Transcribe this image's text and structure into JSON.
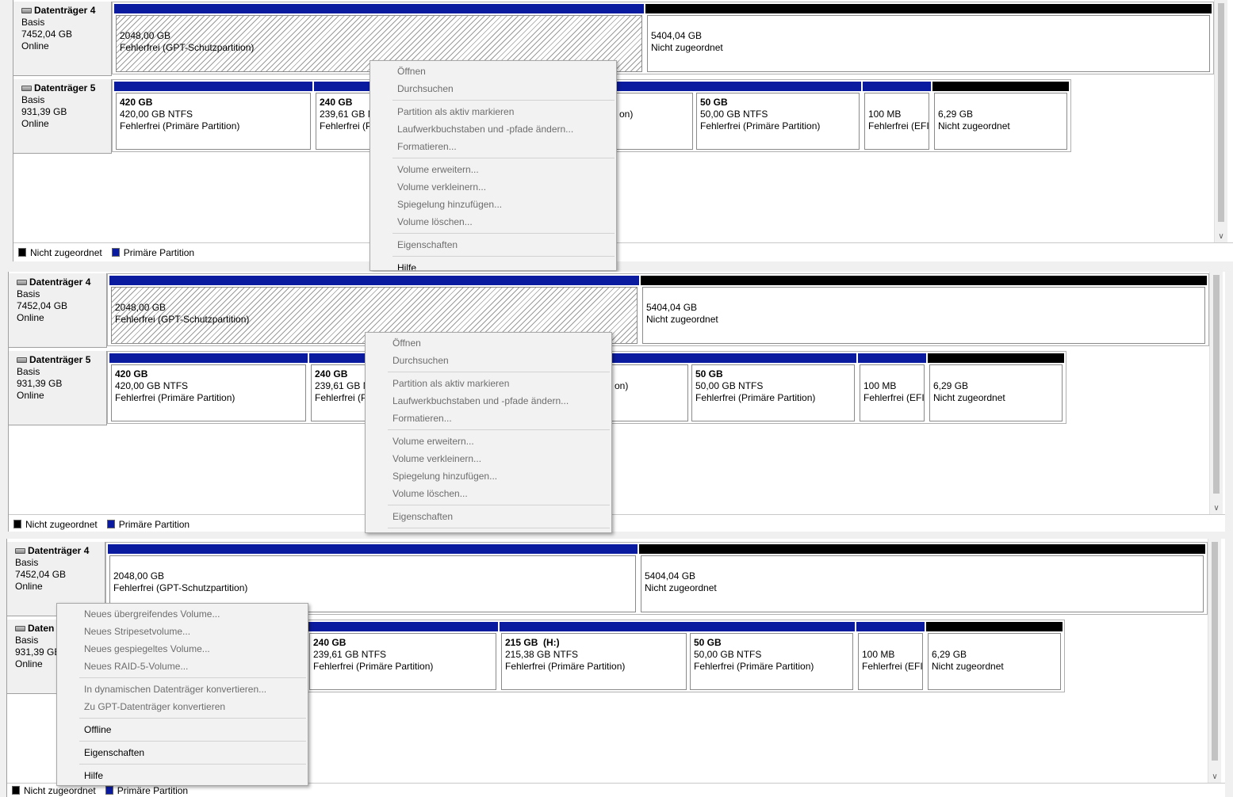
{
  "legend": {
    "unallocated": "Nicht zugeordnet",
    "primary": "Primäre Partition"
  },
  "colors": {
    "primary": "#0a1ba0",
    "unallocated": "#000000"
  },
  "disk4": {
    "name": "Datenträger 4",
    "type": "Basis",
    "capacity": "7452,04 GB",
    "status": "Online",
    "protective": {
      "size": "2048,00 GB",
      "status": "Fehlerfrei (GPT-Schutzpartition)"
    },
    "unallocated": {
      "size": "5404,04 GB",
      "status": "Nicht zugeordnet"
    }
  },
  "disk5": {
    "name": "Datenträger 5",
    "name_truncated": "Daten",
    "type": "Basis",
    "capacity": "931,39 GB",
    "status": "Online",
    "p420": {
      "title": "420 GB",
      "detail": "420,00 GB NTFS",
      "status": "Fehlerfrei (Primäre Partition)"
    },
    "p240": {
      "title": "240 GB",
      "detail": "239,61 GB NTFS",
      "status": "Fehlerfrei (Primäre Partition)"
    },
    "p240_truncated": {
      "detail": "239,61 GB NT",
      "status": "Fehlerfrei (Pri"
    },
    "p215": {
      "title": "215 GB  (H:)",
      "detail": "215,38 GB NTFS",
      "status": "Fehlerfrei (Primäre Partition)"
    },
    "p215_fragment": {
      "status": "on)"
    },
    "p50": {
      "title": "50 GB",
      "detail": "50,00 GB NTFS",
      "status": "Fehlerfrei (Primäre Partition)"
    },
    "efi": {
      "detail": "100 MB",
      "status": "Fehlerfrei (EFI-"
    },
    "unallocated": {
      "detail": "6,29 GB",
      "status": "Nicht zugeordnet"
    }
  },
  "partition_menu": {
    "open": "Öffnen",
    "explore": "Durchsuchen",
    "mark_active": "Partition als aktiv markieren",
    "change_letter": "Laufwerkbuchstaben und -pfade ändern...",
    "format": "Formatieren...",
    "extend": "Volume erweitern...",
    "shrink": "Volume verkleinern...",
    "add_mirror": "Spiegelung hinzufügen...",
    "delete": "Volume löschen...",
    "properties": "Eigenschaften",
    "help": "Hilfe"
  },
  "disk_menu": {
    "spanned": "Neues übergreifendes Volume...",
    "striped": "Neues Stripesetvolume...",
    "mirrored": "Neues gespiegeltes Volume...",
    "raid5": "Neues RAID-5-Volume...",
    "to_dynamic": "In dynamischen Datenträger konvertieren...",
    "to_gpt": "Zu GPT-Datenträger konvertieren",
    "offline": "Offline",
    "properties": "Eigenschaften",
    "help": "Hilfe"
  }
}
